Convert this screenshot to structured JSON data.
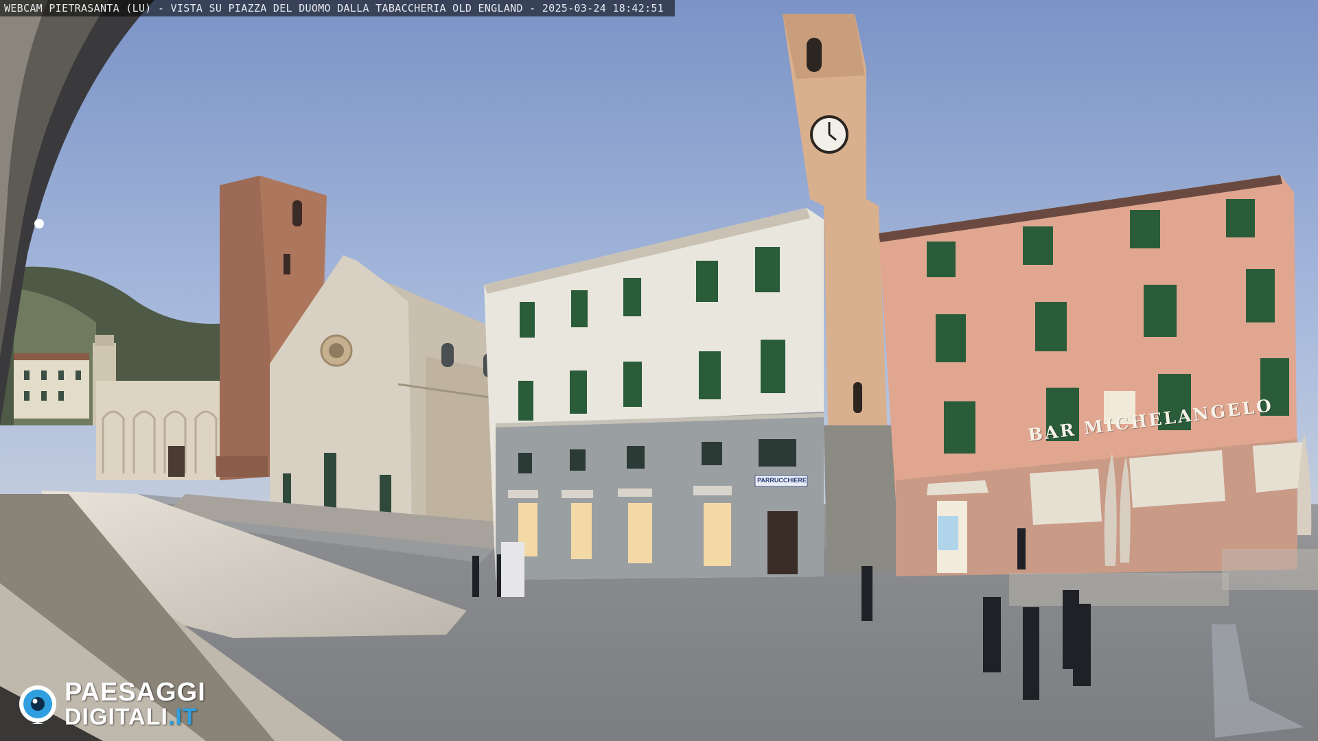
{
  "overlay": {
    "caption": "WEBCAM PIETRASANTA (LU) - VISTA SU PIAZZA DEL DUOMO DALLA TABACCHERIA OLD ENGLAND - 2025-03-24 18:42:51"
  },
  "signs": {
    "bar_name": "BAR MICHELANGELO",
    "parrucchiere": "PARRUCCHIERE"
  },
  "logo": {
    "line1": "PAESAGGI",
    "line2_main": "DIGITALI",
    "line2_accent": ".IT",
    "accent_color": "#2f9fe0",
    "icon": "camera-eye-icon"
  },
  "colors": {
    "sky_top": "#7f97c9",
    "pink_building": "#e0a690",
    "white_building": "#e9e6de",
    "cathedral_marble": "#d8d0c2",
    "brick_tower": "#9c6a55",
    "bell_tower": "#d9b08e",
    "shutter_green": "#2a5c3a"
  }
}
